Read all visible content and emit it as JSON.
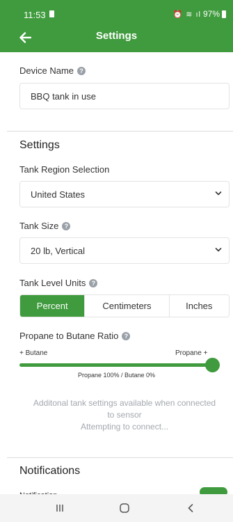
{
  "status_bar": {
    "time": "11:53",
    "icons": "⏰ ≋ ıl",
    "battery": "97%"
  },
  "header": {
    "title": "Settings"
  },
  "device_name": {
    "label": "Device Name",
    "value": "BBQ tank in use"
  },
  "settings": {
    "title": "Settings",
    "region": {
      "label": "Tank Region Selection",
      "value": "United States"
    },
    "tank_size": {
      "label": "Tank Size",
      "value": "20 lb, Vertical"
    },
    "level_units": {
      "label": "Tank Level Units",
      "options": [
        "Percent",
        "Centimeters",
        "Inches"
      ],
      "selected": "Percent"
    },
    "ratio": {
      "label": "Propane to Butane Ratio",
      "left_label": "+ Butane",
      "right_label": "Propane +",
      "readout": "Propane 100% / Butane 0%",
      "value_fraction": 1.0
    },
    "info_line1": "Additonal tank settings available when connected",
    "info_line2": "to sensor",
    "status": "Attempting to connect..."
  },
  "notifications": {
    "title": "Notifications",
    "partial_label": "Notification",
    "toggle_on": true
  },
  "colors": {
    "accent": "#3f9b3d",
    "muted_text": "#a3a8ae"
  }
}
